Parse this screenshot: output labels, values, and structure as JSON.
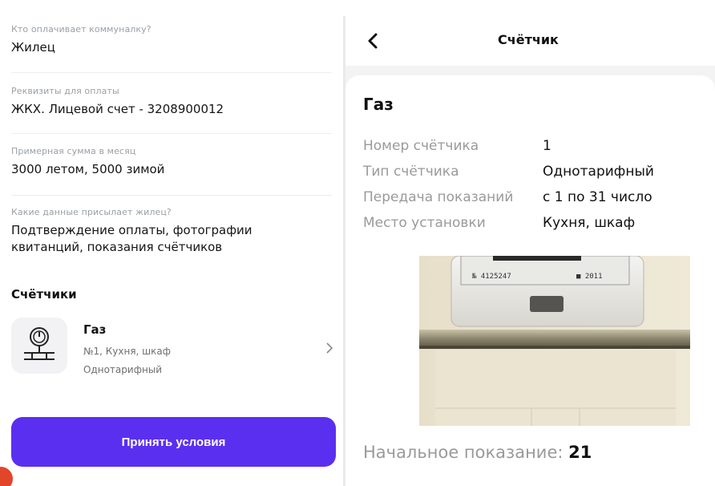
{
  "left": {
    "fields": [
      {
        "label": "Кто оплачивает коммуналку?",
        "value": "Жилец"
      },
      {
        "label": "Реквизиты для оплаты",
        "value": "ЖКХ. Лицевой счет - 3208900012"
      },
      {
        "label": "Примерная сумма в месяц",
        "value": "3000 летом, 5000 зимой"
      },
      {
        "label": "Какие данные присылает жилец?",
        "value": "Подтверждение оплаты, фотографии квитанций, показания счётчиков"
      }
    ],
    "meters_title": "Счётчики",
    "meter": {
      "name": "Газ",
      "details": "№1, Кухня, шкаф",
      "tariff": "Однотарифный",
      "icon": "gas-meter-icon"
    },
    "accept_button": "Принять условия"
  },
  "right": {
    "header_title": "Счётчик",
    "back_icon": "chevron-left-icon",
    "card_title": "Газ",
    "info": [
      {
        "key": "Номер счётчика",
        "value": "1"
      },
      {
        "key": "Тип счётчика",
        "value": "Однотарифный"
      },
      {
        "key": "Передача показаний",
        "value": "с 1 по 31 число"
      },
      {
        "key": "Место установки",
        "value": "Кухня, шкаф"
      }
    ],
    "photo": {
      "serial_text": "№ 4125247",
      "year_text": "■ 2011"
    },
    "reading_label": "Начальное показание:",
    "reading_value": "21"
  },
  "colors": {
    "accent": "#5b2ff0",
    "muted_text": "#9a9a9a",
    "panel_bg": "#f3f3f3"
  }
}
